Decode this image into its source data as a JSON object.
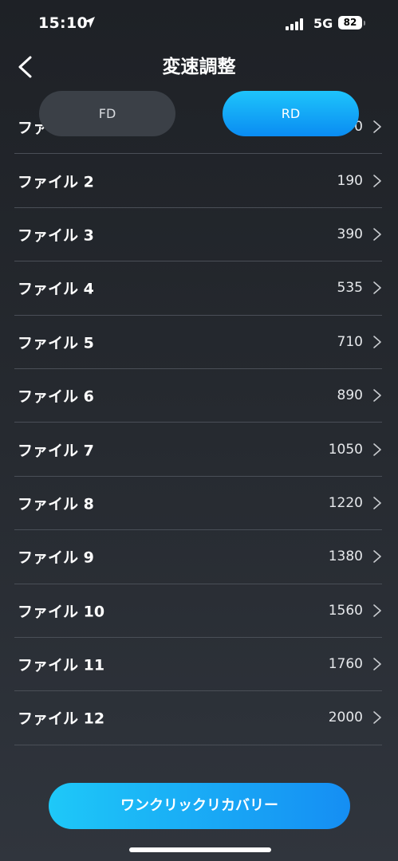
{
  "status_bar": {
    "time": "15:10",
    "network": "5G",
    "battery": "82"
  },
  "header": {
    "title": "変速調整"
  },
  "tabs": [
    {
      "label": "FD",
      "active": false
    },
    {
      "label": "RD",
      "active": true
    }
  ],
  "files": [
    {
      "label": "ファイル 1",
      "value": "0"
    },
    {
      "label": "ファイル 2",
      "value": "190"
    },
    {
      "label": "ファイル 3",
      "value": "390"
    },
    {
      "label": "ファイル 4",
      "value": "535"
    },
    {
      "label": "ファイル 5",
      "value": "710"
    },
    {
      "label": "ファイル 6",
      "value": "890"
    },
    {
      "label": "ファイル 7",
      "value": "1050"
    },
    {
      "label": "ファイル 8",
      "value": "1220"
    },
    {
      "label": "ファイル 9",
      "value": "1380"
    },
    {
      "label": "ファイル 10",
      "value": "1560"
    },
    {
      "label": "ファイル 11",
      "value": "1760"
    },
    {
      "label": "ファイル 12",
      "value": "2000"
    }
  ],
  "recovery_button": {
    "label": "ワンクリックリカバリー"
  },
  "colors": {
    "accent": "#1aa6f6",
    "background": "#262a30",
    "divider": "#4a4f57",
    "inactive_tab": "#3b4047"
  }
}
